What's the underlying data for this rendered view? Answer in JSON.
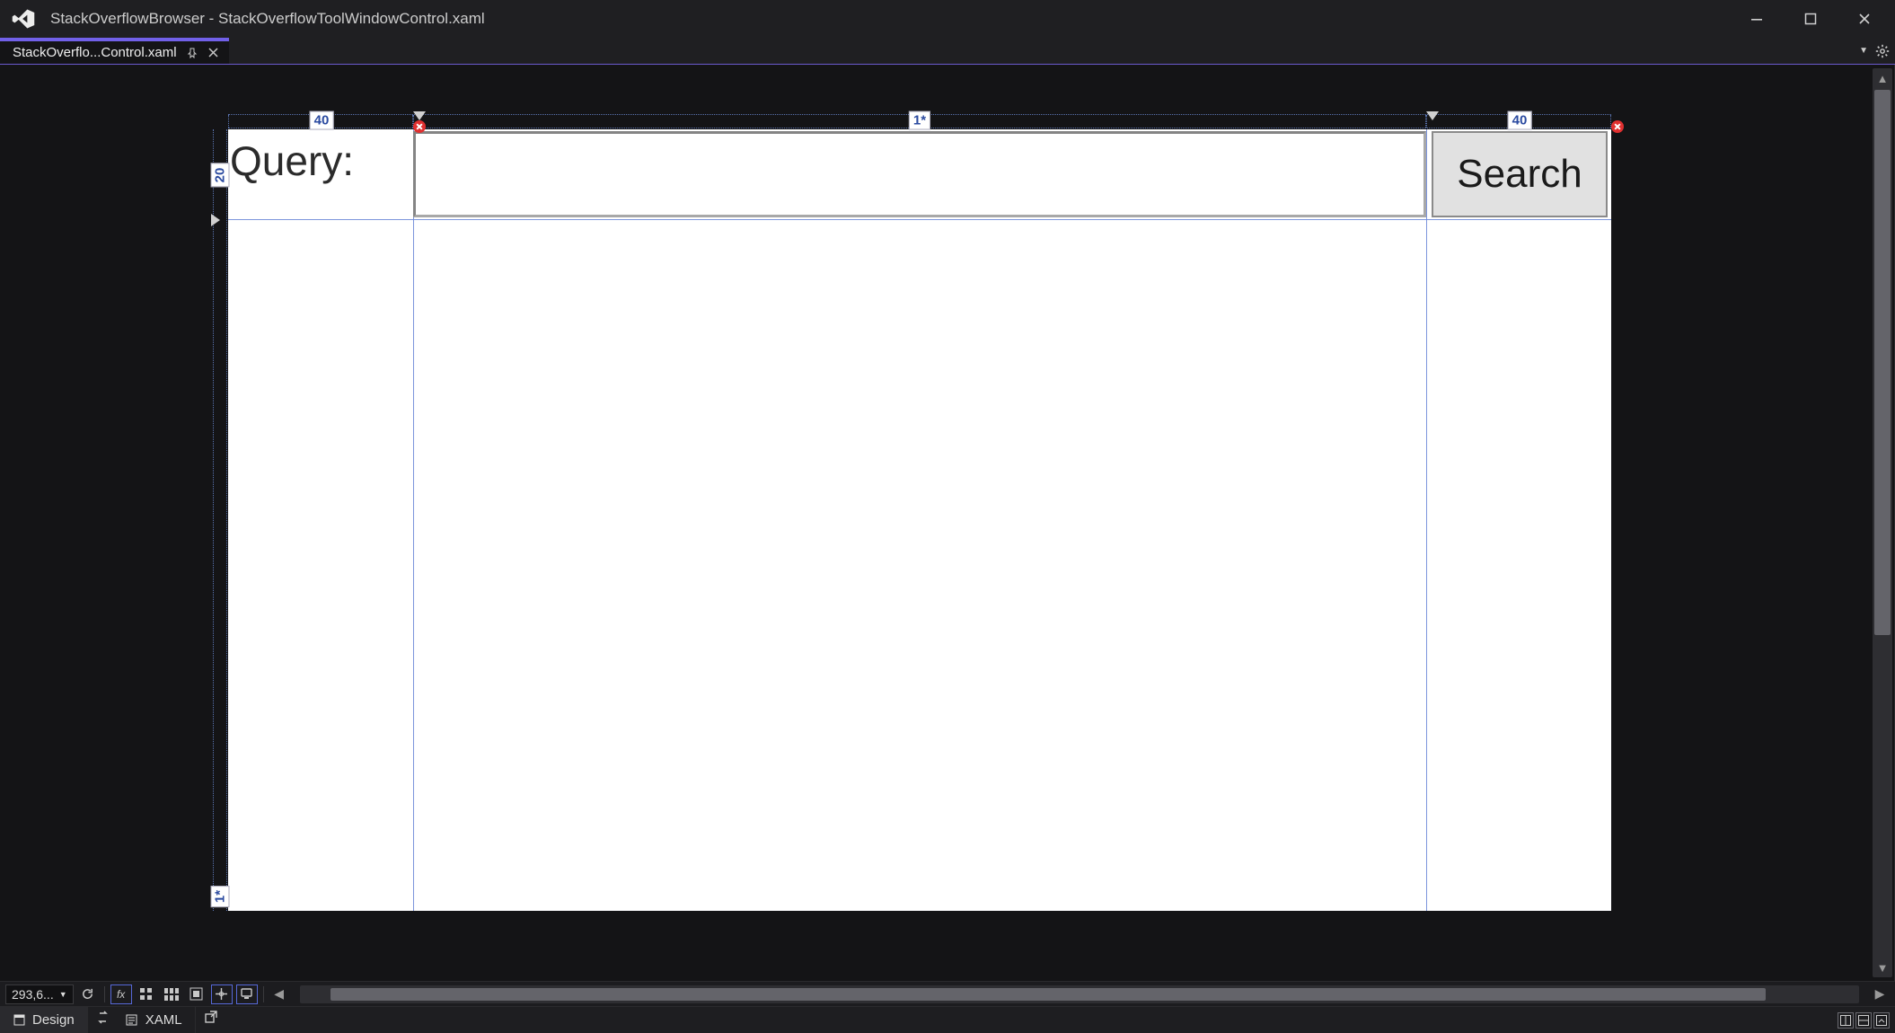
{
  "window": {
    "app_name": "StackOverflowBrowser",
    "document_name": "StackOverflowToolWindowControl.xaml",
    "title": "StackOverflowBrowser - StackOverflowToolWindowControl.xaml"
  },
  "tab": {
    "label": "StackOverflo...Control.xaml"
  },
  "designer": {
    "zoom_display": "293,6...",
    "columns": [
      {
        "size": "40"
      },
      {
        "size": "1*"
      },
      {
        "size": "40"
      }
    ],
    "rows": [
      {
        "size": "20"
      },
      {
        "size": "1*"
      }
    ],
    "query_label": "Query:",
    "query_value": "",
    "search_label": "Search"
  },
  "panes": {
    "design": "Design",
    "xaml": "XAML"
  },
  "colors": {
    "accent": "#7160e8",
    "guide": "#6e8ad8"
  }
}
